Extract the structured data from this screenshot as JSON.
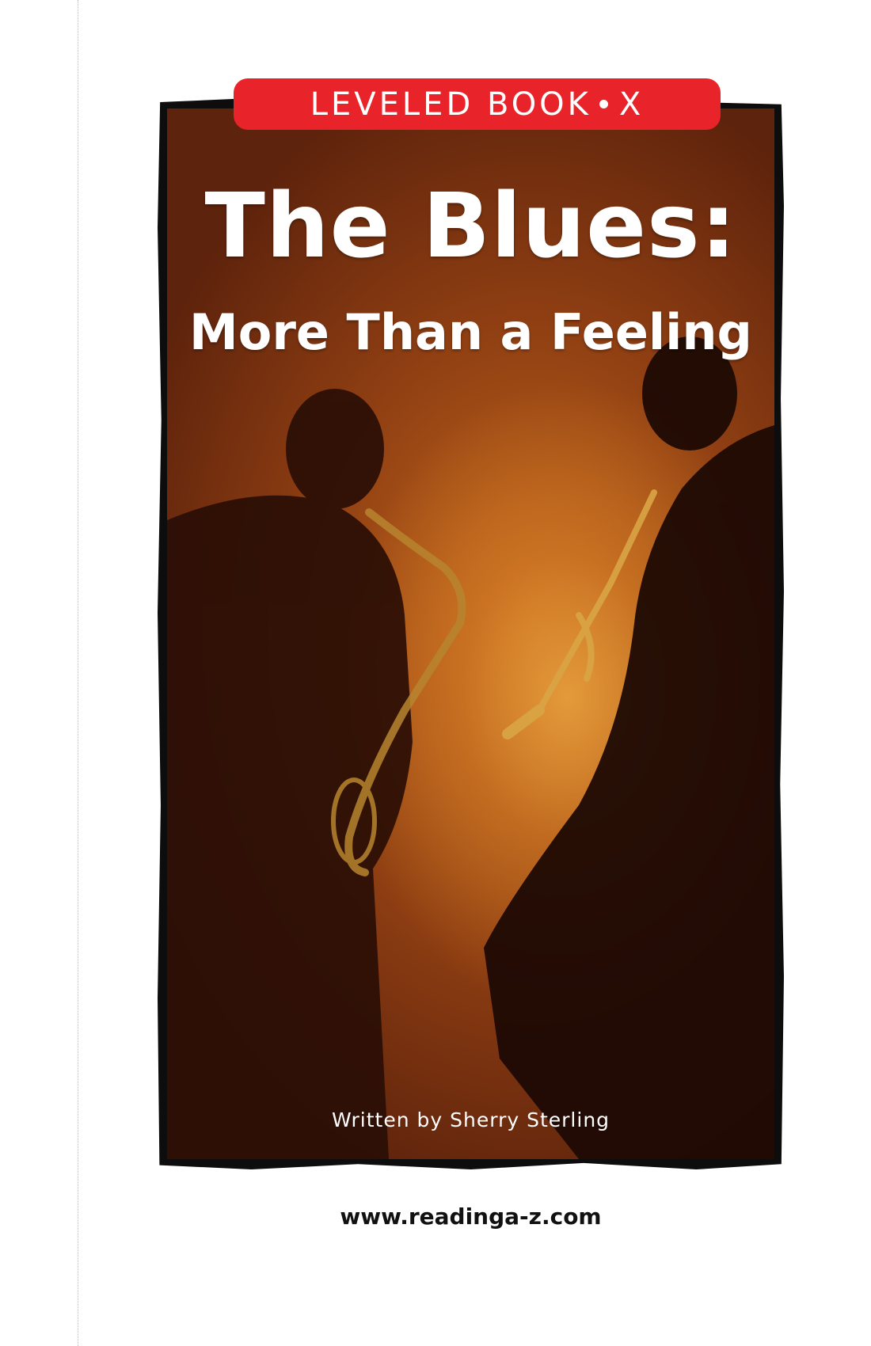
{
  "banner": {
    "label": "LEVELED BOOK",
    "level": "X",
    "color": "#e8232a"
  },
  "title": {
    "main": "The Blues:",
    "subtitle": "More Than a Feeling"
  },
  "cover_image": {
    "icons": [
      "saxophone-icon",
      "trumpet-icon"
    ]
  },
  "byline": "Written by Sherry Sterling",
  "website": "www.readinga-z.com"
}
